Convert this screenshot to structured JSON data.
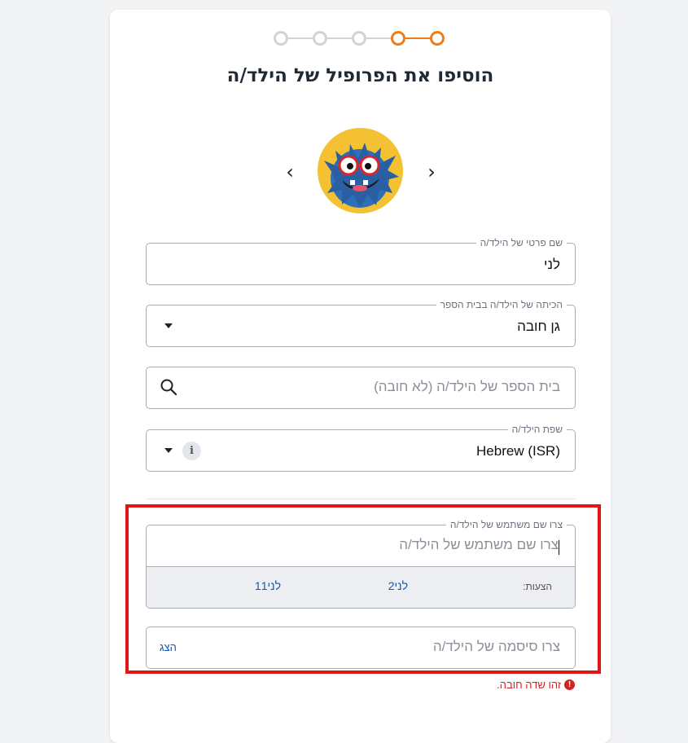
{
  "title": "הוסיפו את הפרופיל של הילד/ה",
  "stepper": {
    "total": 5,
    "current": 5
  },
  "avatar": {
    "prev_label": "‹",
    "next_label": "›",
    "icon": "blue-monster-avatar"
  },
  "first_name": {
    "legend": "שם פרטי של הילד/ה",
    "value": "לני"
  },
  "grade": {
    "legend": "הכיתה של הילד/ה בבית הספר",
    "value": "גן חובה"
  },
  "school": {
    "placeholder": "בית הספר של הילד/ה (לא חובה)",
    "icon": "search-icon"
  },
  "language": {
    "legend": "שפת הילד/ה",
    "value": "Hebrew (ISR)",
    "info": "i"
  },
  "username": {
    "legend": "צרו שם משתמש של הילד/ה",
    "placeholder": "צרו שם משתמש של הילד/ה",
    "suggestions_label": "הצעות:",
    "suggestions": [
      "לני2",
      "לני11"
    ]
  },
  "password": {
    "placeholder": "צרו סיסמה של הילד/ה",
    "show_label": "הצג"
  },
  "error": {
    "icon": "!",
    "text": "זהו שדה חובה."
  },
  "colors": {
    "accent": "#f07c1a",
    "link": "#1a56a8",
    "error": "#d32222",
    "highlight": "#e01616"
  }
}
